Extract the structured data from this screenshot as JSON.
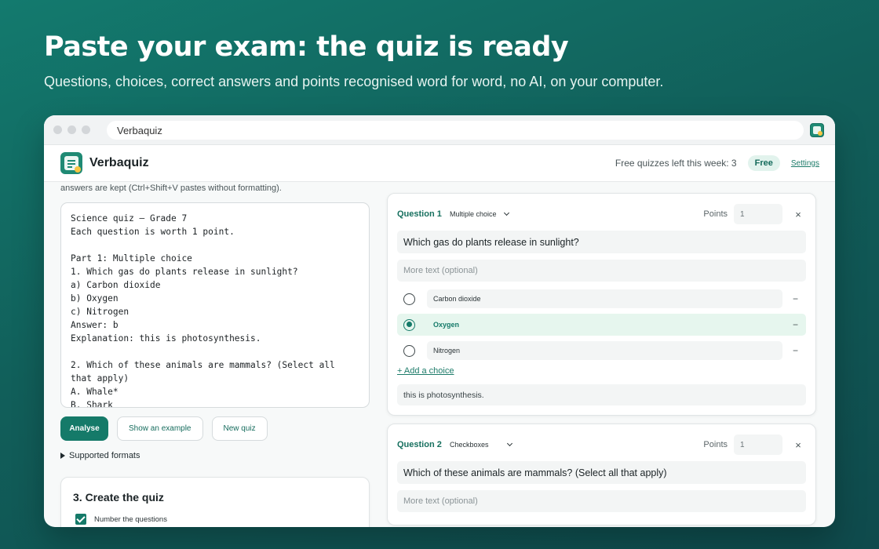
{
  "hero": {
    "title": "Paste your exam: the quiz is ready",
    "subtitle": "Questions, choices, correct answers and points recognised word for word, no AI, on your computer."
  },
  "browser": {
    "url": "Verbaquiz"
  },
  "app": {
    "name": "Verbaquiz",
    "free_left": "Free quizzes left this week: 3",
    "badge": "Free",
    "settings": "Settings"
  },
  "editor": {
    "hint": "answers are kept (Ctrl+Shift+V pastes without formatting).",
    "text": "Science quiz – Grade 7\nEach question is worth 1 point.\n\nPart 1: Multiple choice\n1. Which gas do plants release in sunlight?\na) Carbon dioxide\nb) Oxygen\nc) Nitrogen\nAnswer: b\nExplanation: this is photosynthesis.\n\n2. Which of these animals are mammals? (Select all that apply)\nA. Whale*\nB. Shark"
  },
  "buttons": {
    "analyse": "Analyse",
    "example": "Show an example",
    "new_quiz": "New quiz"
  },
  "formats": {
    "label": "Supported formats"
  },
  "create": {
    "title": "3. Create the quiz",
    "number_questions": "Number the questions",
    "number_checked": true
  },
  "colors": {
    "accent": "#157a69",
    "correct_bg": "#e6f6ee",
    "background": "#116259"
  },
  "questions": [
    {
      "label": "Question 1",
      "type": "Multiple choice",
      "points_label": "Points",
      "points": "1",
      "text": "Which gas do plants release in sunlight?",
      "more_placeholder": "More text (optional)",
      "choices": [
        {
          "text": "Carbon dioxide",
          "correct": false
        },
        {
          "text": "Oxygen",
          "correct": true
        },
        {
          "text": "Nitrogen",
          "correct": false
        }
      ],
      "add_choice": "+ Add a choice",
      "explanation": "this is photosynthesis."
    },
    {
      "label": "Question 2",
      "type": "Checkboxes",
      "points_label": "Points",
      "points": "1",
      "text": "Which of these animals are mammals? (Select all that apply)",
      "more_placeholder": "More text (optional)"
    }
  ],
  "icons": {
    "close": "×",
    "remove": "−"
  }
}
